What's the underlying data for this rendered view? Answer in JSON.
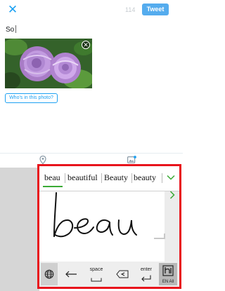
{
  "compose": {
    "char_count": "114",
    "tweet_label": "Tweet",
    "text": "So",
    "who_in_photo_label": "Who's in this photo?"
  },
  "icons": {
    "close": "close-icon",
    "remove_photo": "close-icon",
    "location": "location-pin-icon",
    "add_photo": "add-photo-icon",
    "accent": "#1da1f2"
  },
  "keyboard": {
    "candidates": [
      "beau",
      "beautiful",
      "Beauty",
      "beauty"
    ],
    "handwriting_ink": "beau",
    "preview_word": "beau",
    "keys": {
      "space": "space",
      "enter": "enter",
      "lang": "EN All"
    },
    "highlight_color": "#e8141c",
    "accent_color": "#3aaa35"
  }
}
